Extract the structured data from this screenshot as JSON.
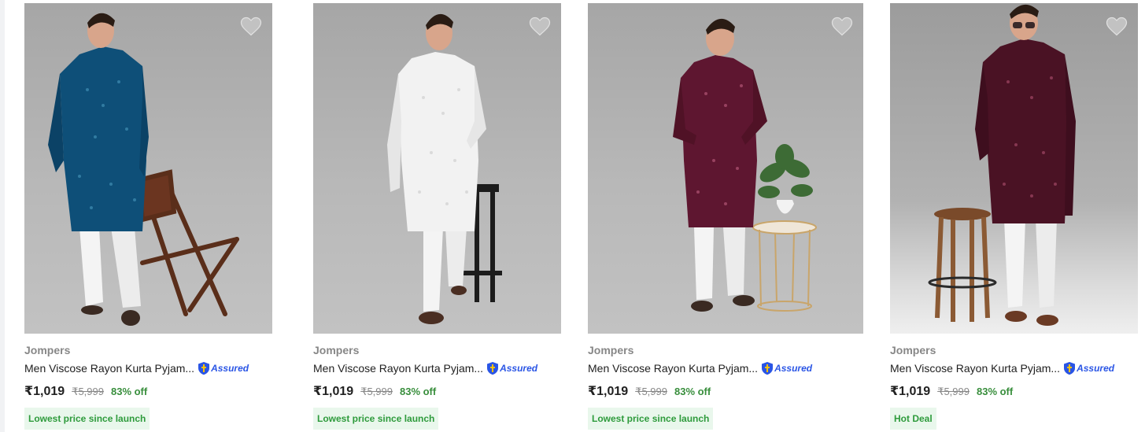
{
  "products": [
    {
      "brand": "Jompers",
      "title": "Men Viscose Rayon Kurta Pyjam...",
      "assured": "Assured",
      "price": "₹1,019",
      "mrp": "₹5,999",
      "discount": "83% off",
      "tag": "Lowest price since launch",
      "kurta_color": "#0e4f78"
    },
    {
      "brand": "Jompers",
      "title": "Men Viscose Rayon Kurta Pyjam...",
      "assured": "Assured",
      "price": "₹1,019",
      "mrp": "₹5,999",
      "discount": "83% off",
      "tag": "Lowest price since launch",
      "kurta_color": "#f2f2f2"
    },
    {
      "brand": "Jompers",
      "title": "Men Viscose Rayon Kurta Pyjam...",
      "assured": "Assured",
      "price": "₹1,019",
      "mrp": "₹5,999",
      "discount": "83% off",
      "tag": "Lowest price since launch",
      "kurta_color": "#5e1630"
    },
    {
      "brand": "Jompers",
      "title": "Men Viscose Rayon Kurta Pyjam...",
      "assured": "Assured",
      "price": "₹1,019",
      "mrp": "₹5,999",
      "discount": "83% off",
      "tag": "Hot Deal",
      "kurta_color": "#4a1224"
    }
  ],
  "icons": {
    "wishlist": "heart-icon",
    "assured": "shield-icon"
  },
  "colors": {
    "price_text": "#212121",
    "brand_text": "#878787",
    "discount_green": "#388e3c",
    "tag_bg": "#e9f7ec",
    "assured_blue": "#2a55e5"
  }
}
